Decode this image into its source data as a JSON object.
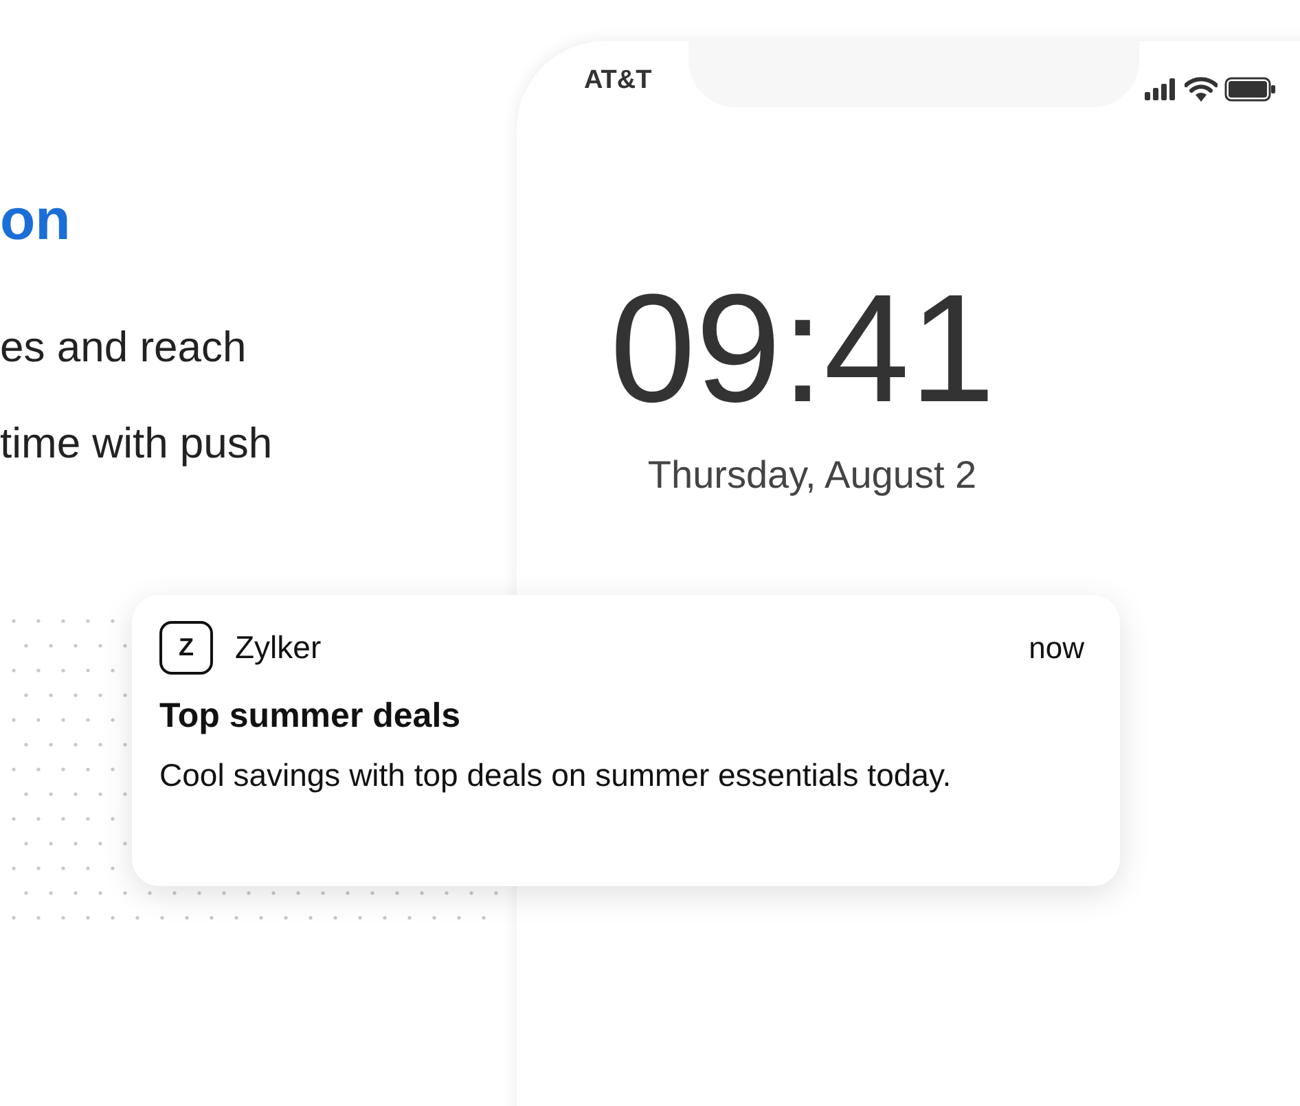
{
  "hero": {
    "heading": "on",
    "lines": [
      "es and reach",
      "time with push"
    ]
  },
  "phone": {
    "carrier": "AT&T",
    "time": "09:41",
    "date": "Thursday, August 2"
  },
  "notification": {
    "app_icon": "Z",
    "app": "Zylker",
    "time": "now",
    "title": "Top summer deals",
    "body": "Cool savings with top deals on summer essentials today."
  }
}
